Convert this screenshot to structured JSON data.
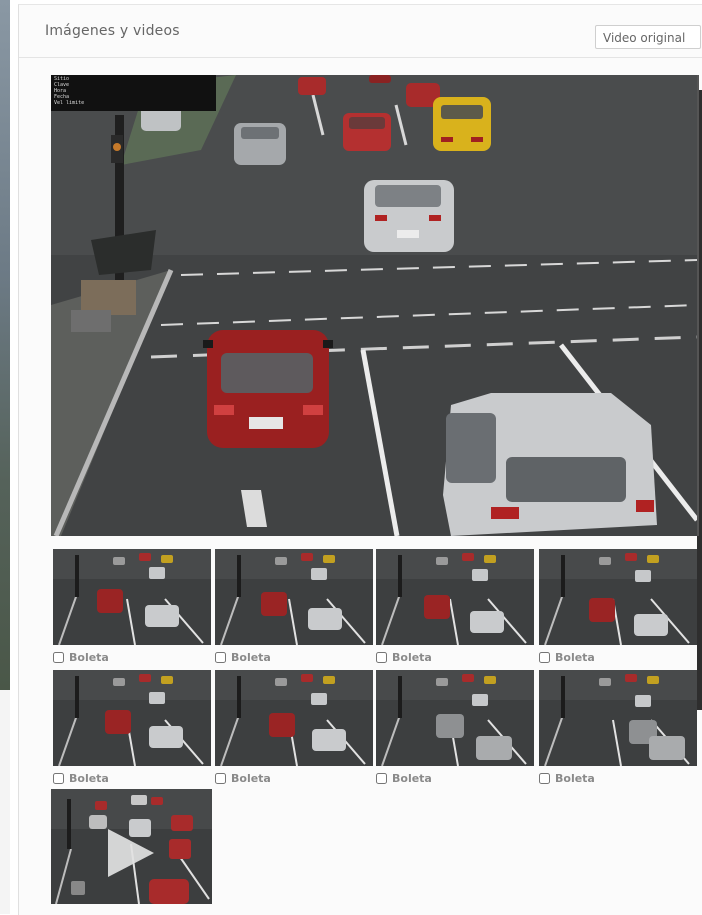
{
  "panel": {
    "title": "Imágenes y videos",
    "video_button_label": "Video original"
  },
  "camera_overlay": {
    "lines": [
      "Sitio",
      "Clave",
      "Hora",
      "Fecha",
      "Vel limite"
    ]
  },
  "thumbnails": [
    {
      "checkbox_label": "Boleta",
      "checked": false
    },
    {
      "checkbox_label": "Boleta",
      "checked": false
    },
    {
      "checkbox_label": "Boleta",
      "checked": false
    },
    {
      "checkbox_label": "Boleta",
      "checked": false
    },
    {
      "checkbox_label": "Boleta",
      "checked": false
    },
    {
      "checkbox_label": "Boleta",
      "checked": false
    },
    {
      "checkbox_label": "Boleta",
      "checked": false
    },
    {
      "checkbox_label": "Boleta",
      "checked": false
    }
  ],
  "video_thumbnail": {
    "icon": "play-icon"
  },
  "colors": {
    "road": "#3c3e3f",
    "lane_marking": "#e8e8e8",
    "red_car": "#9a2020",
    "silver_car": "#c9cbcd",
    "yellow_taxi": "#d9b21c"
  }
}
